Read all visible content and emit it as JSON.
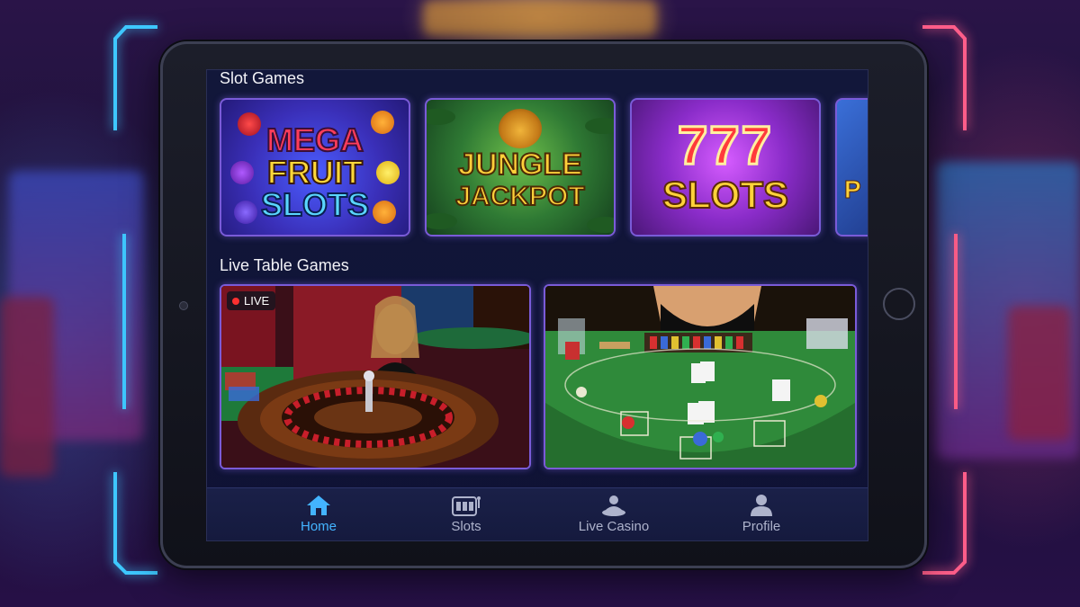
{
  "sections": {
    "slots_title": "Slot Games",
    "live_title": "Live Table Games"
  },
  "slot_games": [
    {
      "lines": [
        "MEGA",
        "FRUIT",
        "SLOTS"
      ]
    },
    {
      "lines": [
        "JUNGLE",
        "JACKPOT"
      ]
    },
    {
      "lines": [
        "777",
        "SLOTS"
      ]
    },
    {
      "lines": [
        "P"
      ]
    }
  ],
  "live_games": {
    "badge": "LIVE"
  },
  "nav": {
    "items": [
      {
        "label": "Home",
        "icon": "home-icon",
        "active": true
      },
      {
        "label": "Slots",
        "icon": "slot-machine-icon",
        "active": false
      },
      {
        "label": "Live Casino",
        "icon": "dealer-icon",
        "active": false
      },
      {
        "label": "Profile",
        "icon": "user-icon",
        "active": false
      }
    ]
  },
  "colors": {
    "accent_active": "#43b4ff",
    "card_border": "#7a5bd8",
    "neon_left": "#3ec8ff",
    "neon_right": "#ff5e8a"
  }
}
